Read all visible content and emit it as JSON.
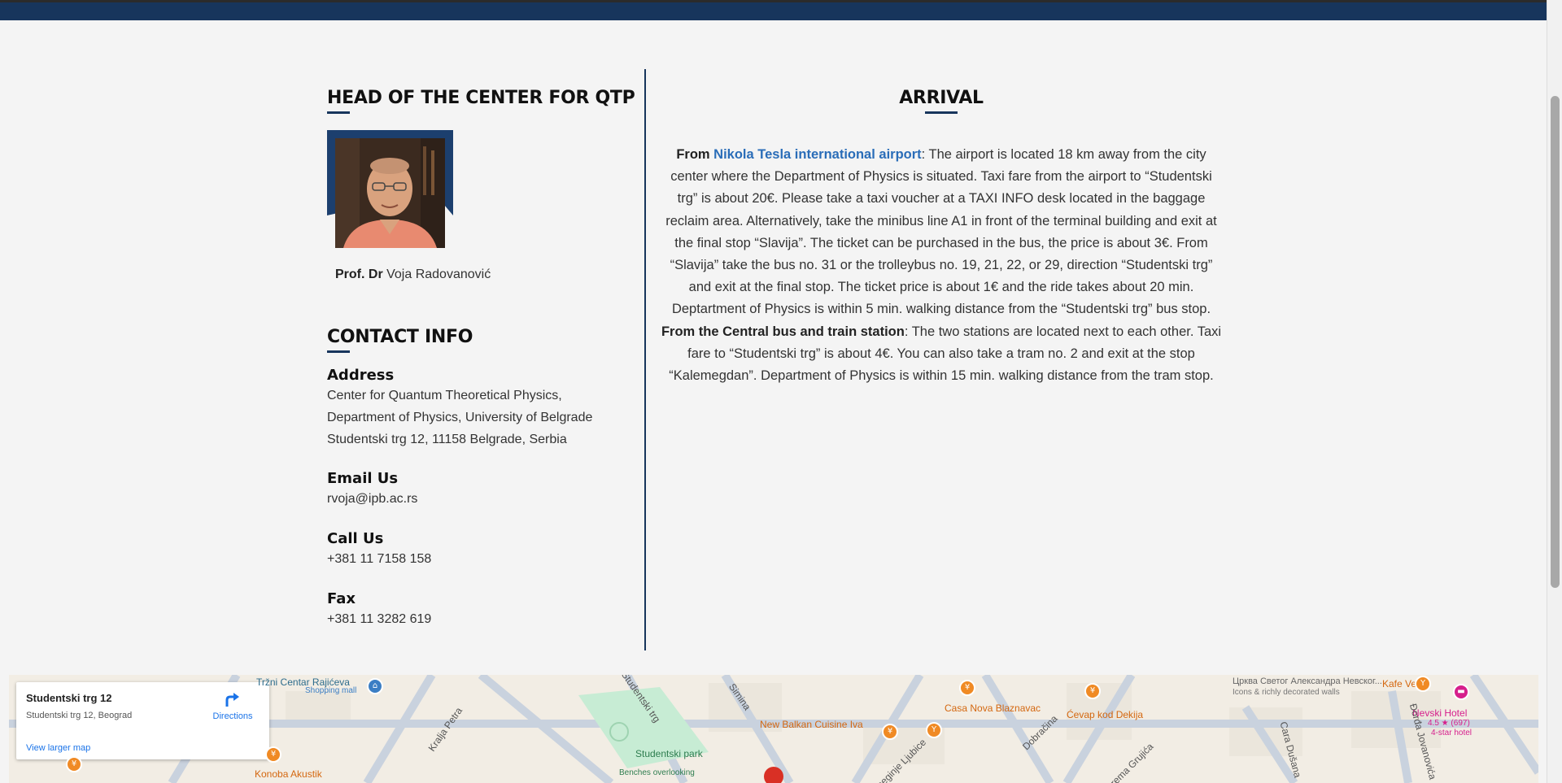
{
  "head": {
    "title": "HEAD OF THE CENTER FOR QTP",
    "prof_prefix": "Prof. Dr",
    "prof_name": " Voja Radovanović"
  },
  "contact": {
    "title": "CONTACT INFO",
    "address_label": "Address",
    "address_lines": [
      "Center for Quantum Theoretical Physics,",
      "Department of Physics, University of Belgrade",
      "Studentski trg 12, 11158 Belgrade, Serbia"
    ],
    "email_label": "Email Us",
    "email": "rvoja@ipb.ac.rs",
    "call_label": "Call Us",
    "phone": "+381 11 7158 158",
    "fax_label": "Fax",
    "fax": "+381 11 3282 619"
  },
  "arrival": {
    "title": "ARRIVAL",
    "from1": "From ",
    "airport_link": "Nikola Tesla international airport",
    "text1": ": The airport is located 18 km away from the city center where the Department of Physics is situated. Taxi fare from the airport to “Studentski trg” is about 20€. Please take a taxi voucher at a TAXI INFO desk located in the baggage reclaim area. Alternatively, take the minibus line A1 in front of the terminal building and exit at the final stop “Slavija”. The ticket can be purchased in the bus, the price is about 3€. From “Slavija” take the bus no. 31 or the trolleybus no. 19, 21, 22, or 29, direction “Studentski trg” and exit at the final stop. The ticket price is about 1€ and the ride takes about 20 min. Deptartment of Physics is within 5 min. walking distance from the “Studentski trg” bus stop. ",
    "from2": "From the Central bus and train station",
    "text2": ": The two stations are located next to each other. Taxi fare to “Studentski trg” is about 4€. You can also take a tram no. 2 and exit at the stop “Kalemegdan”. Department of Physics is within 15 min. walking distance from the tram stop."
  },
  "map": {
    "info_title": "Studentski trg 12",
    "info_address": "Studentski trg 12, Beograd",
    "directions": "Directions",
    "larger_map": "View larger map",
    "labels": {
      "trzni": "Tržni Centar Rajićeva",
      "shopping": "Shopping mall",
      "kralja_petra": "Kralja Petra",
      "studentski_trg_street": "Studentski trg",
      "simina": "Simina",
      "studentski_park": "Studentski park",
      "benches": "Benches overlooking",
      "konoba": "Konoba Akustik",
      "new_balkan": "New Balkan Cuisine Iva",
      "casa_nova": "Casa Nova Blaznavac",
      "dobracina": "Dobračina",
      "cevap": "Ćevap kod Dekija",
      "cerkva": "Црква Светог Александра Невског...",
      "icons": "Icons & richly decorated walls",
      "kafe_veza": "Kafe Veza",
      "nevski": "Nevski Hotel",
      "nevski_rating": "4.5 ★ (697)",
      "nevski_type": "4-star hotel",
      "cara_dusana": "Cara Dušana",
      "dorda": "Đorđa Jovanovića",
      "kneginje": "Kneginje Ljubice",
      "sitejeva": "Jevrema Grujića"
    }
  }
}
